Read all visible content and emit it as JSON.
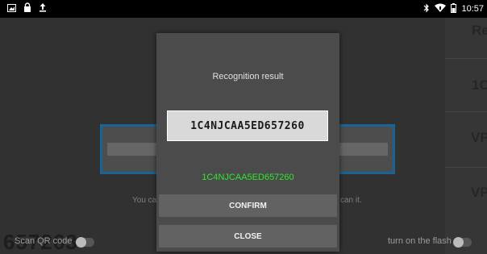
{
  "status_bar": {
    "time": "10:57",
    "left_icons": [
      "image-icon",
      "lock-icon",
      "upload-icon"
    ],
    "right_icons": [
      "bluetooth-icon",
      "wifi-icon",
      "battery-icon"
    ]
  },
  "background": {
    "right_panel_labels": [
      "Re",
      "1C",
      "VP",
      "VP"
    ],
    "hint_left": "You ca",
    "hint_right": "can it.",
    "big_text": "657263",
    "scan_qr_label": "Scan QR code",
    "flash_label": "turn on the flash"
  },
  "dialog": {
    "title": "Recognition result",
    "code_image_text": "1C4NJCAA5ED657260",
    "result_text": "1C4NJCAA5ED657260",
    "confirm_label": "CONFIRM",
    "close_label": "CLOSE"
  },
  "colors": {
    "scan_frame": "#1e7bb7",
    "result_text": "#2de82d",
    "dialog_bg": "#4b4b4b",
    "button_bg": "#626262"
  }
}
